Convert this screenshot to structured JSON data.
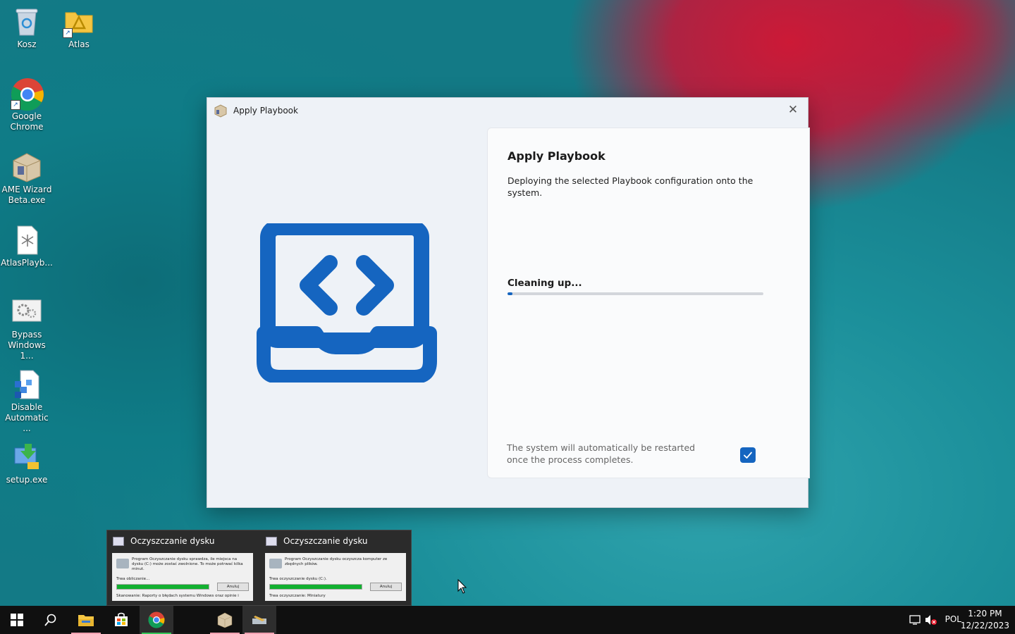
{
  "desktop": {
    "icons": [
      {
        "label": "Kosz",
        "icon": "recycle-bin-icon"
      },
      {
        "label": "Atlas",
        "icon": "folder-shortcut-icon"
      },
      {
        "label": "Google Chrome",
        "icon": "chrome-icon"
      },
      {
        "label": "AME Wizard Beta.exe",
        "icon": "ame-wizard-icon"
      },
      {
        "label": "AtlasPlayb...",
        "icon": "playbook-file-icon"
      },
      {
        "label": "Bypass Windows 1...",
        "icon": "gears-icon"
      },
      {
        "label": "Disable Automatic ...",
        "icon": "script-icon"
      },
      {
        "label": "setup.exe",
        "icon": "setup-icon"
      }
    ]
  },
  "window": {
    "title": "Apply Playbook",
    "heading": "Apply Playbook",
    "description": "Deploying the selected Playbook configuration onto the system.",
    "status": "Cleaning up...",
    "progress": 0.02,
    "restart_note": "The system will automatically be restarted once the process completes.",
    "restart_checked": true,
    "accent": "#1565c0"
  },
  "thumbnails": [
    {
      "title": "Oczyszczanie dysku",
      "text": "Program Oczyszczanie dysku sprawdza, ile miejsca na dysku (C:) może zostać zwolnione. To może potrwać kilka minut.",
      "label": "Trwa obliczanie...",
      "button": "Anuluj",
      "footer": "Skanowanie: Raporty o błędach systemu Windows oraz opinie i"
    },
    {
      "title": "Oczyszczanie dysku",
      "text": "Program Oczyszczanie dysku oczyszcza komputer ze zbędnych plików.",
      "label": "Trwa oczyszczanie dysku (C:).",
      "button": "Anuluj",
      "footer": "Trwa oczyszczanie: Miniatury"
    }
  ],
  "taskbar": {
    "buttons": [
      "start-icon",
      "search-icon",
      "file-explorer-icon",
      "store-icon",
      "chrome-icon",
      "ame-wizard-icon",
      "disk-cleanup-icon"
    ],
    "language": "POL",
    "time": "1:20 PM",
    "date": "12/22/2023"
  }
}
